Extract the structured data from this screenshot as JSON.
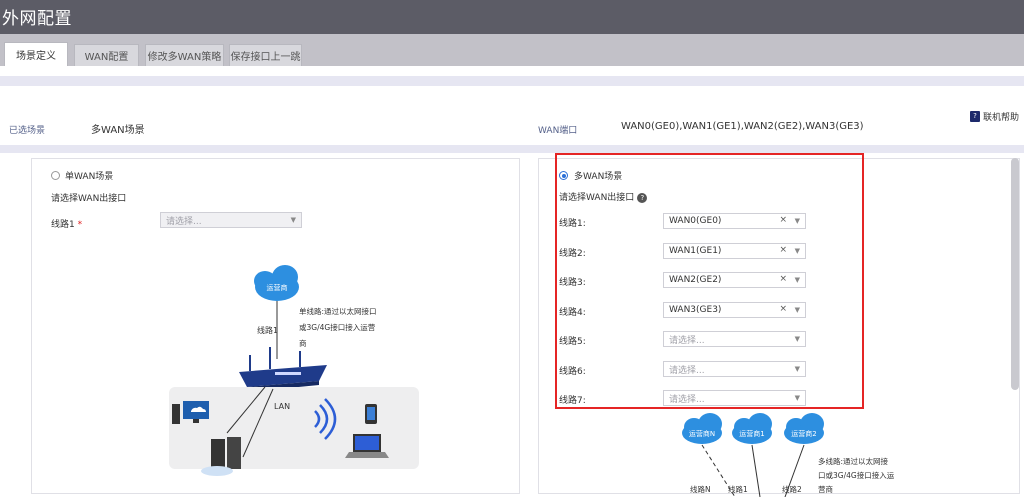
{
  "header": {
    "title": "外网配置"
  },
  "tabs": [
    {
      "label": "场景定义",
      "active": true
    },
    {
      "label": "WAN配置",
      "active": false
    },
    {
      "label": "修改多WAN策略",
      "active": false
    },
    {
      "label": "保存接口上一跳",
      "active": false
    }
  ],
  "summary": {
    "scene_label": "已选场景",
    "scene_value": "多WAN场景",
    "wan_label": "WAN端口",
    "wan_value": "WAN0(GE0),WAN1(GE1),WAN2(GE2),WAN3(GE3)",
    "help_label": "联机帮助"
  },
  "single": {
    "radio_label": "单WAN场景",
    "selected": false,
    "prompt": "请选择WAN出接口",
    "line_label": "线路1",
    "required_mark": "*",
    "select_placeholder": "请选择...",
    "diagram": {
      "isp": "运营商",
      "line": "线路1",
      "note1": "单线路:通过以太网接口",
      "note2": "或3G/4G接口接入运营",
      "note3": "商",
      "lan": "LAN"
    }
  },
  "multi": {
    "radio_label": "多WAN场景",
    "selected": true,
    "prompt": "请选择WAN出接口",
    "help_icon": "question-circle-icon",
    "lines": [
      {
        "label": "线路1:",
        "value": "WAN0(GE0)",
        "placeholder": ""
      },
      {
        "label": "线路2:",
        "value": "WAN1(GE1)",
        "placeholder": ""
      },
      {
        "label": "线路3:",
        "value": "WAN2(GE2)",
        "placeholder": ""
      },
      {
        "label": "线路4:",
        "value": "WAN3(GE3)",
        "placeholder": ""
      },
      {
        "label": "线路5:",
        "value": "",
        "placeholder": "请选择..."
      },
      {
        "label": "线路6:",
        "value": "",
        "placeholder": "请选择..."
      },
      {
        "label": "线路7:",
        "value": "",
        "placeholder": "请选择..."
      }
    ],
    "clear_glyph": "×",
    "diagram": {
      "isp_n": "运营商N",
      "isp_1": "运营商1",
      "isp_2": "运营商2",
      "line_n": "线路N",
      "line_1": "线路1",
      "line_2": "线路2",
      "note1": "多线路:通过以太网接",
      "note2": "口或3G/4G接口接入运",
      "note3": "营商"
    }
  },
  "colors": {
    "titlebar": "#5c5c66",
    "tabbar": "#c2c1c8",
    "radio_on": "#2c6fd6",
    "highlight_box": "#e52525",
    "cloud": "#2d8fe0"
  }
}
